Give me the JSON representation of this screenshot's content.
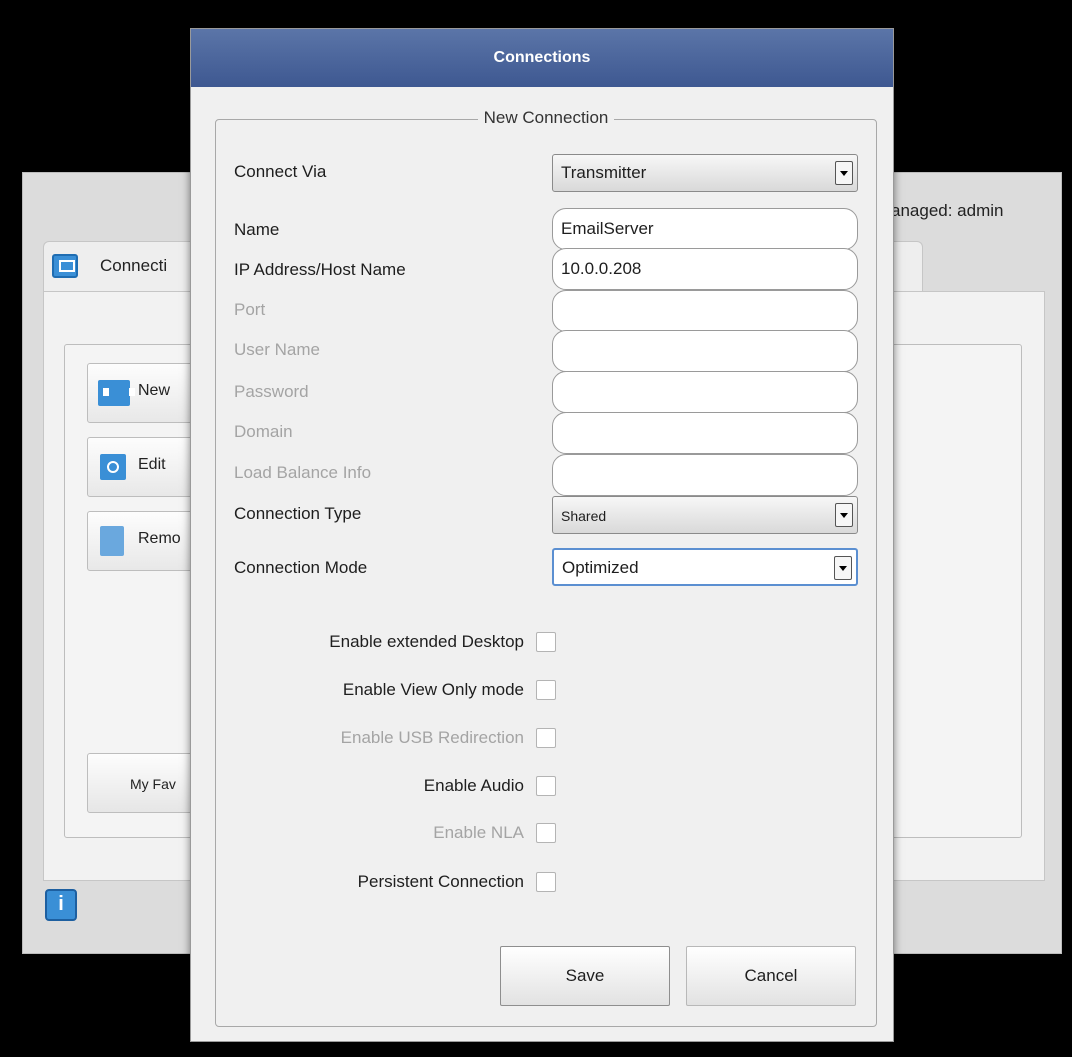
{
  "background_window": {
    "manager_text": "anaged: admin",
    "tab_label": "Connecti",
    "buttons": {
      "new_label": "New",
      "edit_label": "Edit",
      "remove_label": "Remo",
      "favorites_label": "My Fav"
    }
  },
  "dialog": {
    "title": "Connections",
    "group_title": "New Connection",
    "connect_via": {
      "label": "Connect Via",
      "value": "Transmitter"
    },
    "name": {
      "label": "Name",
      "value": "EmailServer"
    },
    "host": {
      "label": "IP Address/Host Name",
      "value": "10.0.0.208"
    },
    "port": {
      "label": "Port",
      "value": ""
    },
    "username": {
      "label": "User Name",
      "value": ""
    },
    "password": {
      "label": "Password",
      "value": ""
    },
    "domain": {
      "label": "Domain",
      "value": ""
    },
    "load_balance": {
      "label": "Load Balance Info",
      "value": ""
    },
    "connection_type": {
      "label": "Connection Type",
      "value": "Shared"
    },
    "connection_mode": {
      "label": "Connection Mode",
      "value": "Optimized"
    },
    "options": {
      "extended_desktop": "Enable extended Desktop",
      "view_only": "Enable View Only mode",
      "usb_redirection": "Enable USB Redirection",
      "audio": "Enable Audio",
      "nla": "Enable NLA",
      "persistent": "Persistent Connection"
    },
    "save_label": "Save",
    "cancel_label": "Cancel"
  }
}
